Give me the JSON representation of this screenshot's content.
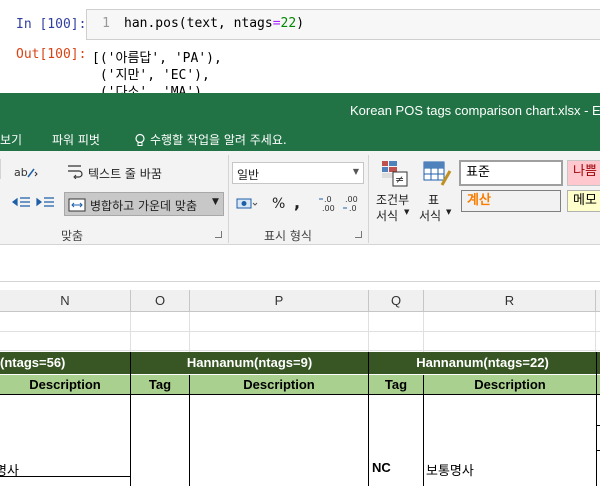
{
  "jupyter": {
    "in_prompt": "In [100]:",
    "out_prompt": "Out[100]:",
    "line_number": "1",
    "code_prefix": "han.pos(text, ntags",
    "code_eq": "=",
    "code_num": "22",
    "code_suffix": ")",
    "output_lines": [
      "[('아름답', 'PA'),",
      " ('지만', 'EC'),",
      " ('다소', 'MA')"
    ]
  },
  "excel": {
    "window_title": "Korean POS tags comparison chart.xlsx - Excel",
    "menu": {
      "view": "보기",
      "power_pivot": "파워 피벗",
      "tell_me": "수행할 작업을 알려 주세요."
    },
    "ribbon": {
      "wrap_text": "텍스트 줄 바꿈",
      "merge_center": "병합하고 가운데 맞춤",
      "alignment_group": "맞춤",
      "number_format": "일반",
      "percent": "%",
      "comma": ",",
      "inc_decimal": "←.0\n.00",
      "dec_decimal": ".00\n→.0",
      "number_group": "표시 형식",
      "conditional_format": "조건부",
      "conditional_format2": "서식",
      "table_format": "표",
      "table_format2": "서식",
      "styles": {
        "normal": "표준",
        "bad": "나쁨",
        "calculation": "계산",
        "note": "메모"
      }
    },
    "columns": [
      "N",
      "O",
      "P",
      "Q",
      "R"
    ],
    "group_headers": [
      "(ntags=56)",
      "Hannanum(ntags=9)",
      "Hannanum(ntags=22)"
    ],
    "sub_headers": [
      "Description",
      "Tag",
      "Description",
      "Tag",
      "Description"
    ],
    "row_cells": {
      "n_desc": "명사",
      "q_tag": "NC",
      "r_desc": "보통명사"
    },
    "colors": {
      "excel_green": "#217346",
      "header_dark": "#375623",
      "header_light": "#a9d08e",
      "bad_style": "#ffc7ce",
      "calc_style": "#f2f2f2",
      "note_style": "#ffffcc"
    }
  }
}
